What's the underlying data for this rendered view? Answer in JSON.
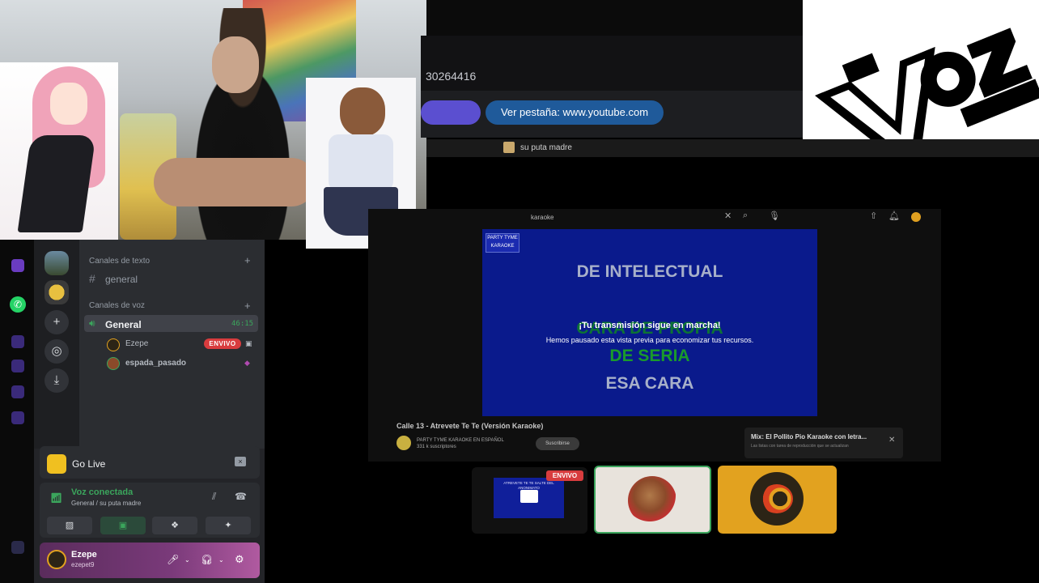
{
  "browser": {
    "url_fragment": "30264416",
    "tab_button_left": "",
    "tab_button_youtube": "Ver pestaña: www.youtube.com",
    "notification_text": "su puta madre"
  },
  "youtube": {
    "search_query": "karaoke",
    "channel_logo_text": "PARTY TYME KARAOKE",
    "lyrics": [
      "DE INTELECTUAL",
      "CARA DE PROPIA",
      "DE SERIA",
      "ESA CARA"
    ],
    "overlay_title": "¡Tu transmisión sigue en marcha!",
    "overlay_subtitle": "Hemos pausado esta vista previa para economizar tus recursos.",
    "video_title": "Calle 13 - Atrevete Te Te (Versión Karaoke)",
    "channel_name": "PARTY TYME KARAOKE EN ESPAÑOL",
    "channel_subs": "331 k suscriptores",
    "subscribe_label": "Suscribirse",
    "mix_title": "Mix: El Pollito Pio Karaoke con letra...",
    "mix_sub": "Las listas con tarea de reproducción que se actualizan"
  },
  "stream_tiles": {
    "live_badge": "ENVIVO",
    "tile1_text": "ATREVETE TE TE SALTE DEL ANONIMATO"
  },
  "discord": {
    "text_category": "Canales de texto",
    "text_channel": "general",
    "voice_category": "Canales de voz",
    "voice_channel": "General",
    "voice_timer": "46:15",
    "user1": "Ezepe",
    "user1_badge": "ENVIVO",
    "user2": "espada_pasado",
    "go_live_label": "Go Live",
    "voice_connected": "Voz conectada",
    "voice_location": "General / su puta madre",
    "current_user_name": "Ezepe",
    "current_user_handle": "ezepet9"
  },
  "icons": {
    "whatsapp": "whatsapp-icon",
    "speaker": "speaker-icon",
    "signal": "signal-icon",
    "gear": "gear-icon",
    "mic": "mic-icon",
    "headphones": "headphones-icon"
  },
  "colors": {
    "discord_green": "#3ba55c",
    "live_red": "#d83c3e",
    "karaoke_blue": "#0a1a8c",
    "youtube_pill": "#1f5a9a",
    "tile_gold": "#e2a21f"
  }
}
